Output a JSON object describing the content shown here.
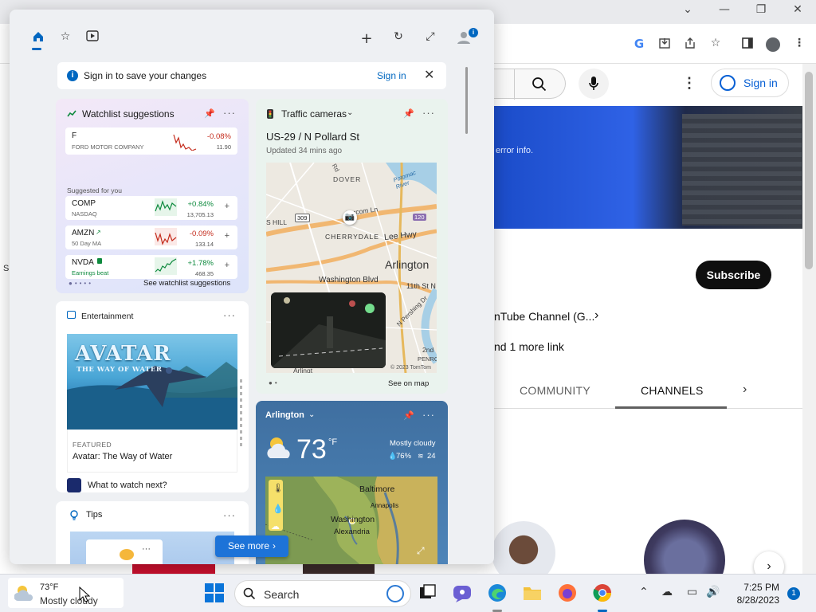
{
  "browser": {
    "window_controls": {
      "minimize": "—",
      "restore": "❐",
      "close": "✕",
      "tab_list": "⌄"
    },
    "toolbar_icons": {
      "google": "G"
    }
  },
  "youtube": {
    "sign_in_label": "Sign in",
    "banner_text": "error info.",
    "subscribe_label": "Subscribe",
    "channel_link_1": "nTube Channel (G...",
    "channel_link_2": "nd 1 more link",
    "tabs": [
      {
        "label": "COMMUNITY"
      },
      {
        "label": "CHANNELS"
      }
    ],
    "left_edge_char": "S"
  },
  "widgets": {
    "signin_bar": {
      "message": "Sign in to save your changes",
      "link": "Sign in"
    },
    "watchlist": {
      "title": "Watchlist suggestions",
      "top_stock": {
        "symbol": "F",
        "name": "FORD MOTOR COMPANY",
        "change": "-0.08%",
        "price": "11.90"
      },
      "suggested_label": "Suggested for you",
      "stocks": [
        {
          "symbol": "COMP",
          "name": "NASDAQ",
          "change": "+0.84%",
          "price": "13,705.13"
        },
        {
          "symbol": "AMZN",
          "name": "50 Day MA",
          "change": "-0.09%",
          "price": "133.14"
        },
        {
          "symbol": "NVDA",
          "name": "Earnings beat",
          "change": "+1.78%",
          "price": "468.35"
        }
      ],
      "footer_link": "See watchlist suggestions"
    },
    "traffic": {
      "title": "Traffic cameras",
      "location": "US-29 / N Pollard St",
      "updated": "Updated 34 mins ago",
      "map_labels": {
        "dover": "DOVER",
        "potomac": "Potomac River",
        "hill": "S HILL",
        "route309": "309",
        "lorcom": "Lorcom Ln",
        "route120": "120",
        "cherrydale": "CHERRYDALE",
        "lee_hwy": "Lee Hwy",
        "arlington": "Arlington",
        "washington_blvd": "Washington Blvd",
        "st11": "11th St N",
        "pershing": "N Pershing Dr",
        "second": "2nd",
        "penro": "PENRO",
        "arlingt": "Arlingt",
        "rd": "Rd",
        "copyright": "© 2023 TomTom"
      },
      "footer_link": "See on map"
    },
    "entertainment": {
      "title": "Entertainment",
      "image_title": "AVATAR",
      "image_subtitle": "THE WAY OF WATER",
      "tag": "FEATURED",
      "headline": "Avatar: The Way of Water",
      "footer": "What to watch next?"
    },
    "tips": {
      "title": "Tips"
    },
    "weather": {
      "location": "Arlington",
      "temperature": "73",
      "unit": "°F",
      "condition": "Mostly cloudy",
      "humidity": "76%",
      "wind": "24",
      "map_labels": {
        "baltimore": "Baltimore",
        "annapolis": "Annapolis",
        "washington": "Washington",
        "alexandria": "Alexandria"
      }
    },
    "see_more": "See more"
  },
  "taskbar": {
    "weather_temp": "73°F",
    "weather_cond": "Mostly cloudy",
    "search_label": "Search",
    "time": "7:25 PM",
    "date": "8/28/2023",
    "notification_count": "1"
  },
  "colors": {
    "accent": "#0067c0",
    "positive": "#0e8a3e",
    "negative": "#c42b1c",
    "yt_link": "#065fd4"
  }
}
